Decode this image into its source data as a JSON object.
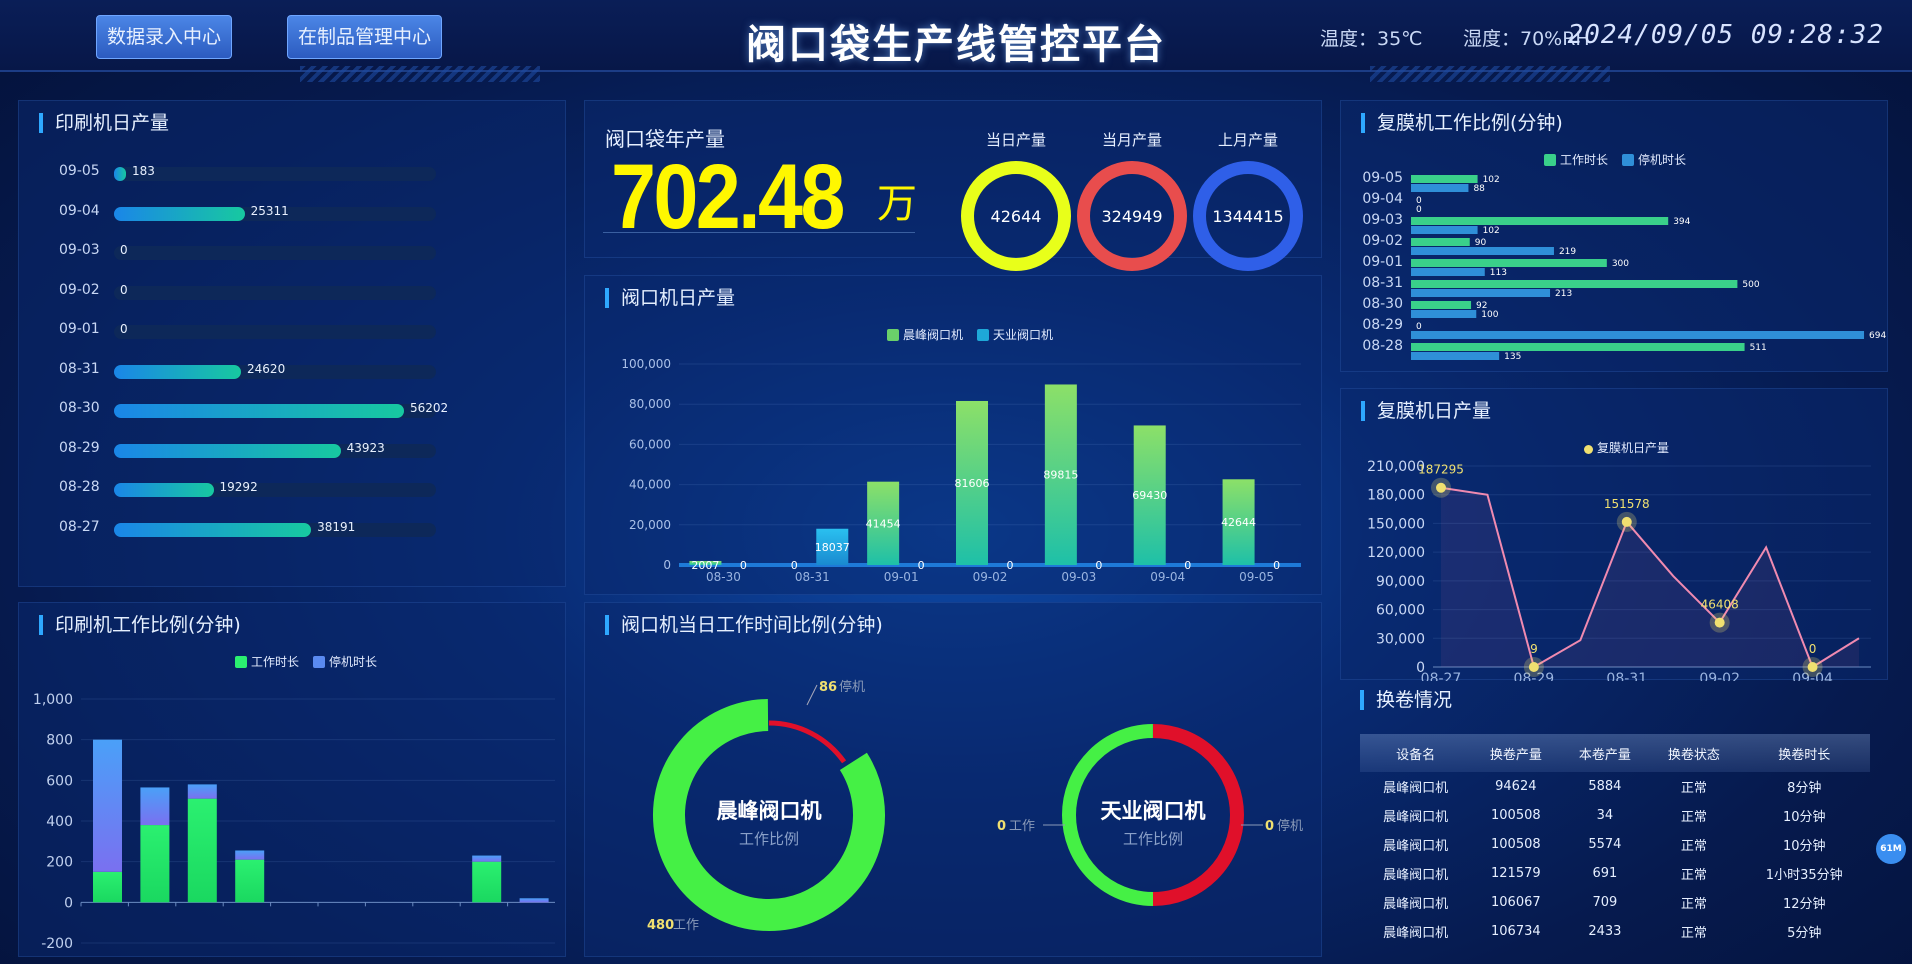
{
  "header": {
    "nav": [
      "数据录入中心",
      "在制品管理中心"
    ],
    "title": "阀口袋生产线管控平台",
    "temperature": "温度：35℃",
    "humidity": "湿度：70%RH",
    "datetime": "2024/09/05 09:28:32"
  },
  "printer_daily": {
    "title": "印刷机日产量",
    "max": 56202,
    "rows": [
      {
        "date": "09-05",
        "value": 183
      },
      {
        "date": "09-04",
        "value": 25311
      },
      {
        "date": "09-03",
        "value": 0
      },
      {
        "date": "09-02",
        "value": 0
      },
      {
        "date": "09-01",
        "value": 0
      },
      {
        "date": "08-31",
        "value": 24620
      },
      {
        "date": "08-30",
        "value": 56202
      },
      {
        "date": "08-29",
        "value": 43923
      },
      {
        "date": "08-28",
        "value": 19292
      },
      {
        "date": "08-27",
        "value": 38191
      }
    ]
  },
  "annual": {
    "label": "阀口袋年产量",
    "value": "702.48",
    "unit": "万",
    "rings": [
      {
        "label": "当日产量",
        "value": "42644",
        "color": "#e8ff1a"
      },
      {
        "label": "当月产量",
        "value": "324949",
        "color": "#e84d4d"
      },
      {
        "label": "上月产量",
        "value": "1344415",
        "color": "#2f5fe8"
      }
    ]
  },
  "valve_daily": {
    "title": "阀口机日产量",
    "legend": [
      "晨峰阀口机",
      "天业阀口机"
    ],
    "colors": {
      "s1": "#6ad06a",
      "s2": "#1ea8d8"
    },
    "chart_data": {
      "type": "bar",
      "categories": [
        "08-30",
        "08-31",
        "09-01",
        "09-02",
        "09-03",
        "09-04",
        "09-05"
      ],
      "series": [
        {
          "name": "晨峰阀口机",
          "values": [
            2007,
            0,
            41454,
            81606,
            89815,
            69430,
            42644
          ]
        },
        {
          "name": "天业阀口机",
          "values": [
            0,
            18037,
            0,
            0,
            0,
            0,
            0
          ]
        }
      ],
      "ylim": [
        0,
        100000
      ],
      "yticks": [
        "0",
        "20,000",
        "40,000",
        "60,000",
        "80,000",
        "100,000"
      ]
    }
  },
  "printer_ratio": {
    "title": "印刷机工作比例(分钟)",
    "legend": [
      "工作时长",
      "停机时长"
    ],
    "chart_data": {
      "type": "bar",
      "series": [
        {
          "name": "工作时长",
          "values": [
            150,
            380,
            510,
            210,
            0,
            0,
            0,
            0,
            200,
            0
          ]
        },
        {
          "name": "停机时长",
          "values": [
            650,
            185,
            70,
            45,
            0,
            0,
            0,
            0,
            30,
            20
          ]
        }
      ],
      "ylim": [
        -200,
        1000
      ],
      "yticks": [
        "-200",
        "0",
        "200",
        "400",
        "600",
        "800",
        "1,000"
      ]
    }
  },
  "valve_ratio": {
    "title": "阀口机当日工作时间比例(分钟)",
    "machines": [
      {
        "name": "晨峰阀口机",
        "sub": "工作比例",
        "work": 480,
        "stop": 86,
        "work_label": "工作",
        "stop_label": "停机"
      },
      {
        "name": "天业阀口机",
        "sub": "工作比例",
        "work": 0,
        "stop": 0,
        "work_label": "工作",
        "stop_label": "停机"
      }
    ]
  },
  "lam_ratio": {
    "title": "复膜机工作比例(分钟)",
    "legend": [
      "工作时长",
      "停机时长"
    ],
    "chart_data": {
      "type": "bar",
      "categories": [
        "09-05",
        "09-04",
        "09-03",
        "09-02",
        "09-01",
        "08-31",
        "08-30",
        "08-29",
        "08-28"
      ],
      "series": [
        {
          "name": "工作时长",
          "values": [
            102,
            0,
            394,
            90,
            300,
            500,
            92,
            0,
            511
          ]
        },
        {
          "name": "停机时长",
          "values": [
            88,
            0,
            102,
            219,
            113,
            213,
            100,
            694,
            135
          ]
        }
      ]
    }
  },
  "lam_daily": {
    "title": "复膜机日产量",
    "legend": "复膜机日产量",
    "chart_data": {
      "type": "line",
      "x": [
        "08-27",
        "08-28",
        "08-29",
        "08-30",
        "08-31",
        "09-01",
        "09-02",
        "09-03",
        "09-04",
        "09-05"
      ],
      "values": [
        187295,
        180000,
        9,
        28000,
        151578,
        95000,
        46408,
        125000,
        0,
        30000
      ],
      "labels": [
        187295,
        null,
        9,
        null,
        151578,
        null,
        46408,
        null,
        0,
        null
      ],
      "xticks": [
        "08-27",
        "08-29",
        "08-31",
        "09-02",
        "09-04"
      ],
      "ylim": [
        0,
        210000
      ],
      "yticks": [
        "0",
        "30,000",
        "60,000",
        "90,000",
        "120,000",
        "150,000",
        "180,000",
        "210,000"
      ]
    }
  },
  "swap": {
    "title": "换卷情况",
    "headers": [
      "设备名",
      "换卷产量",
      "本卷产量",
      "换卷状态",
      "换卷时长"
    ],
    "rows": [
      [
        "晨峰阀口机",
        "94624",
        "5884",
        "正常",
        "8分钟"
      ],
      [
        "晨峰阀口机",
        "100508",
        "34",
        "正常",
        "10分钟"
      ],
      [
        "晨峰阀口机",
        "100508",
        "5574",
        "正常",
        "10分钟"
      ],
      [
        "晨峰阀口机",
        "121579",
        "691",
        "正常",
        "1小时35分钟"
      ],
      [
        "晨峰阀口机",
        "106067",
        "709",
        "正常",
        "12分钟"
      ],
      [
        "晨峰阀口机",
        "106734",
        "2433",
        "正常",
        "5分钟"
      ]
    ]
  },
  "badge": "61M"
}
